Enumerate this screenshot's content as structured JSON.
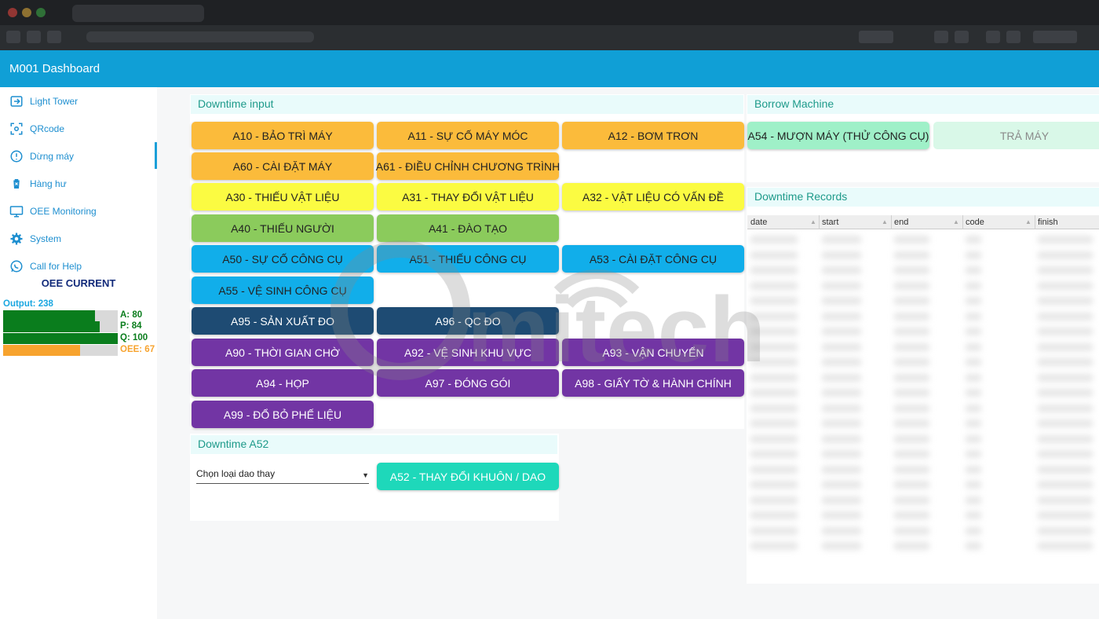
{
  "app": {
    "title": "M001 Dashboard"
  },
  "sidebar": {
    "items": [
      {
        "label": "Light Tower",
        "icon": "exit-to-app-icon"
      },
      {
        "label": "QRcode",
        "icon": "qr-scan-icon"
      },
      {
        "label": "Dừng máy",
        "icon": "alert-circle-icon"
      },
      {
        "label": "Hàng hư",
        "icon": "trash-icon"
      },
      {
        "label": "OEE Monitoring",
        "icon": "monitor-icon"
      },
      {
        "label": "System",
        "icon": "gear-icon"
      },
      {
        "label": "Call for Help",
        "icon": "whatsapp-icon"
      }
    ],
    "oee": {
      "title": "OEE CURRENT",
      "output": "Output: 238",
      "a_label": "A: 80",
      "a_value": 80,
      "p_label": "P: 84",
      "p_value": 84,
      "q_label": "Q: 100",
      "q_value": 100,
      "oee_label": "OEE: 67",
      "oee_value": 67
    }
  },
  "downtime": {
    "title": "Downtime input",
    "buttons": [
      {
        "label": "A10 - BẢO TRÌ MÁY",
        "bg": "#fbbb3b",
        "fg": "#222222"
      },
      {
        "label": "A11 - SỰ CỐ MÁY MÓC",
        "bg": "#fbbb3b",
        "fg": "#222222"
      },
      {
        "label": "A12 - BƠM TRƠN",
        "bg": "#fbbb3b",
        "fg": "#222222"
      },
      {
        "label": "A60 - CÀI ĐẶT MÁY",
        "bg": "#fbbb3b",
        "fg": "#222222"
      },
      {
        "label": "A61 - ĐIỀU CHỈNH CHƯƠNG TRÌNH",
        "bg": "#fbbb3b",
        "fg": "#222222"
      },
      {
        "label": "A30 - THIẾU VẬT LIỆU",
        "bg": "#fbfb42",
        "fg": "#222222"
      },
      {
        "label": "A31 - THAY ĐỔI VẬT LIỆU",
        "bg": "#fbfb42",
        "fg": "#222222"
      },
      {
        "label": "A32 - VẬT LIỆU CÓ VẤN ĐỀ",
        "bg": "#fbfb42",
        "fg": "#222222"
      },
      {
        "label": "A40 - THIẾU NGƯỜI",
        "bg": "#8bcb5c",
        "fg": "#222222"
      },
      {
        "label": "A41 - ĐÀO TẠO",
        "bg": "#8bcb5c",
        "fg": "#222222"
      },
      {
        "label": "A50 - SỰ CỐ CÔNG CỤ",
        "bg": "#11aeea",
        "fg": "#222222"
      },
      {
        "label": "A51 - THIẾU CÔNG CỤ",
        "bg": "#11aeea",
        "fg": "#222222"
      },
      {
        "label": "A53 - CÀI ĐẶT CÔNG CỤ",
        "bg": "#11aeea",
        "fg": "#222222"
      },
      {
        "label": "A55 - VỆ SINH CÔNG CỤ",
        "bg": "#11aeea",
        "fg": "#222222"
      },
      {
        "label": "A95 - SẢN XUẤT ĐO",
        "bg": "#1e4b73",
        "fg": "#ffffff"
      },
      {
        "label": "A96 - QC ĐO",
        "bg": "#1e4b73",
        "fg": "#ffffff"
      },
      {
        "label": "A90 - THỜI GIAN CHỜ",
        "bg": "#7235a4",
        "fg": "#ffffff"
      },
      {
        "label": "A92 - VỆ SINH KHU VỰC",
        "bg": "#7235a4",
        "fg": "#ffffff"
      },
      {
        "label": "A93 - VẬN CHUYỂN",
        "bg": "#7235a4",
        "fg": "#ffffff"
      },
      {
        "label": "A94 - HỌP",
        "bg": "#7235a4",
        "fg": "#ffffff"
      },
      {
        "label": "A97 - ĐÓNG GÓI",
        "bg": "#7235a4",
        "fg": "#ffffff"
      },
      {
        "label": "A98 - GIẤY TỜ & HÀNH CHÍNH",
        "bg": "#7235a4",
        "fg": "#ffffff"
      },
      {
        "label": "A99 - ĐỔ BỎ PHẾ LIỆU",
        "bg": "#7235a4",
        "fg": "#ffffff"
      }
    ]
  },
  "a52": {
    "title": "Downtime A52",
    "select_value": "Chọn loại dao thay",
    "button": {
      "label": "A52 - THAY ĐỔI KHUÔN / DAO",
      "bg": "#1ed8ba",
      "fg": "#ffffff"
    }
  },
  "borrow": {
    "title": "Borrow Machine",
    "borrow_button": {
      "label": "A54 - MƯỢN MÁY (THỬ CÔNG CỤ)",
      "bg": "#9ff0c8",
      "fg": "#222222"
    },
    "return_button": {
      "label": "TRẢ MÁY",
      "bg": "#d9f8e8",
      "fg": "#8a8a8a"
    }
  },
  "records": {
    "title": "Downtime Records",
    "columns": [
      "date",
      "start",
      "end",
      "code",
      "finish"
    ]
  },
  "watermark": {
    "text": "mitech"
  }
}
